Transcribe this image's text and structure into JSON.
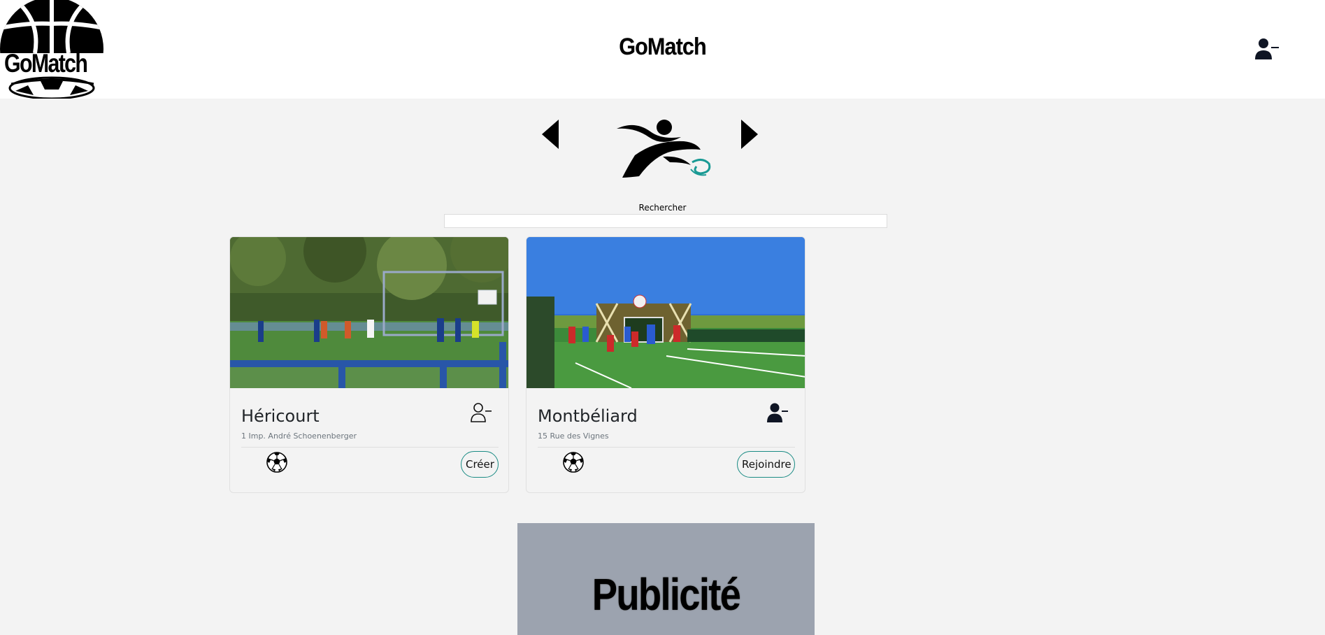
{
  "header": {
    "logo_text": "GoMatch",
    "title": "GoMatch",
    "user_icon": "user-minus-icon"
  },
  "carousel": {
    "prev_icon": "triangle-left-icon",
    "next_icon": "triangle-right-icon",
    "current_sport_icon": "football-player-icon"
  },
  "search": {
    "label": "Rechercher",
    "value": ""
  },
  "cards": [
    {
      "title": "Héricourt",
      "address": "1 Imp. André Schoenenberger",
      "user_icon": "user-minus-outline-icon",
      "sport_icon": "soccer-ball-icon",
      "button_label": "Créer"
    },
    {
      "title": "Montbéliard",
      "address": "15 Rue des Vignes",
      "user_icon": "user-minus-icon",
      "sport_icon": "soccer-ball-icon",
      "button_label": "Rejoindre"
    }
  ],
  "ad": {
    "text": "Publicité"
  },
  "colors": {
    "page_background": "#f3f3f3",
    "header_background": "#ffffff",
    "button_border": "#1a8b84",
    "ad_background": "#9ca3af"
  }
}
